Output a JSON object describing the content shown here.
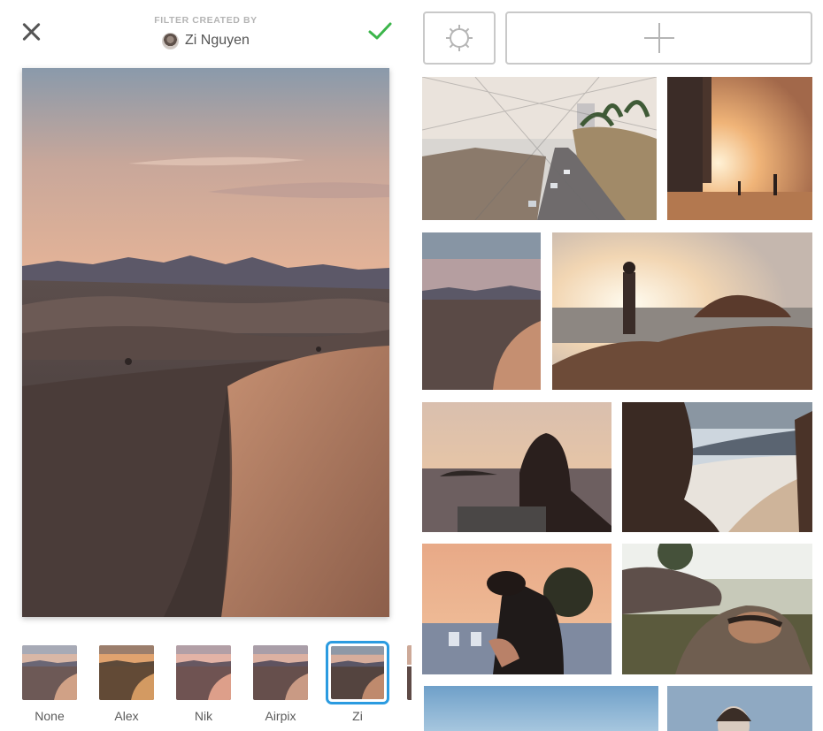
{
  "header": {
    "caption": "FILTER CREATED BY",
    "author_name": "Zi Nguyen"
  },
  "icons": {
    "close": "close-icon",
    "confirm": "checkmark-icon",
    "settings": "gear-icon",
    "add": "plus-icon"
  },
  "colors": {
    "confirm_green": "#3bb54a",
    "selected_ring": "#2b9be0",
    "button_border": "#c9c9c9"
  },
  "filters": [
    {
      "label": "None",
      "selected": false
    },
    {
      "label": "Alex",
      "selected": false
    },
    {
      "label": "Nik",
      "selected": false
    },
    {
      "label": "Airpix",
      "selected": false
    },
    {
      "label": "Zi",
      "selected": true
    }
  ]
}
